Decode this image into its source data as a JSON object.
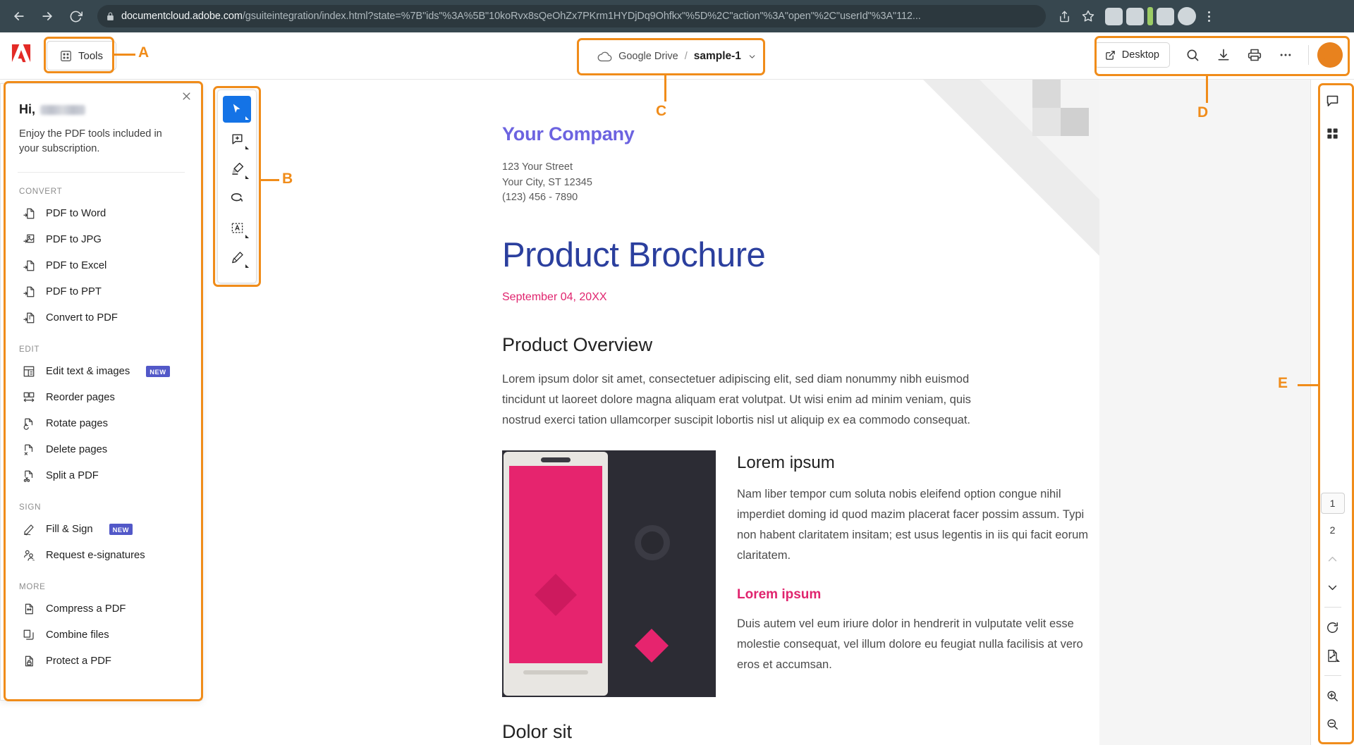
{
  "browser": {
    "url_host": "documentcloud.adobe.com",
    "url_path": "/gsuiteintegration/index.html?state=%7B\"ids\"%3A%5B\"10koRvx8sQeOhZx7PKrm1HYDjDq9Ohfkx\"%5D%2C\"action\"%3A\"open\"%2C\"userId\"%3A\"112...",
    "back_icon": "back-arrow-icon",
    "forward_icon": "forward-arrow-icon",
    "reload_icon": "reload-icon",
    "lock_icon": "lock-icon",
    "share_icon": "share-icon",
    "bookmark_icon": "star-icon",
    "menu_icon": "kebab-menu-icon"
  },
  "header": {
    "logo": "adobe-logo",
    "tools_label": "Tools",
    "tools_icon": "grid-icon",
    "breadcrumb": {
      "cloud_icon": "cloud-icon",
      "source": "Google Drive",
      "separator": "/",
      "file": "sample-1",
      "chevron_icon": "chevron-down-icon"
    },
    "desktop_label": "Desktop",
    "desktop_icon": "external-link-icon",
    "search_icon": "search-icon",
    "download_icon": "download-icon",
    "print_icon": "print-icon",
    "more_icon": "more-horizontal-icon",
    "avatar_icon": "user-avatar-icon"
  },
  "left_panel": {
    "close_icon": "close-icon",
    "greeting": "Hi,",
    "subtitle": "Enjoy the PDF tools included in your subscription.",
    "sections": [
      {
        "title": "CONVERT",
        "items": [
          {
            "label": "PDF to Word",
            "icon": "pdf-to-word-icon",
            "badge": ""
          },
          {
            "label": "PDF to JPG",
            "icon": "pdf-to-jpg-icon",
            "badge": ""
          },
          {
            "label": "PDF to Excel",
            "icon": "pdf-to-excel-icon",
            "badge": ""
          },
          {
            "label": "PDF to PPT",
            "icon": "pdf-to-ppt-icon",
            "badge": ""
          },
          {
            "label": "Convert to PDF",
            "icon": "convert-to-pdf-icon",
            "badge": ""
          }
        ]
      },
      {
        "title": "EDIT",
        "items": [
          {
            "label": "Edit text & images",
            "icon": "edit-text-images-icon",
            "badge": "NEW"
          },
          {
            "label": "Reorder pages",
            "icon": "reorder-pages-icon",
            "badge": ""
          },
          {
            "label": "Rotate pages",
            "icon": "rotate-pages-icon",
            "badge": ""
          },
          {
            "label": "Delete pages",
            "icon": "delete-pages-icon",
            "badge": ""
          },
          {
            "label": "Split a PDF",
            "icon": "split-pdf-icon",
            "badge": ""
          }
        ]
      },
      {
        "title": "SIGN",
        "items": [
          {
            "label": "Fill & Sign",
            "icon": "fill-sign-icon",
            "badge": "NEW"
          },
          {
            "label": "Request e-signatures",
            "icon": "request-esignatures-icon",
            "badge": ""
          }
        ]
      },
      {
        "title": "MORE",
        "items": [
          {
            "label": "Compress a PDF",
            "icon": "compress-pdf-icon",
            "badge": ""
          },
          {
            "label": "Combine files",
            "icon": "combine-files-icon",
            "badge": ""
          },
          {
            "label": "Protect a PDF",
            "icon": "protect-pdf-icon",
            "badge": ""
          }
        ]
      }
    ]
  },
  "annotation_toolbar": {
    "tools": [
      {
        "name": "select-tool",
        "icon": "cursor-icon",
        "active": true
      },
      {
        "name": "add-comment-tool",
        "icon": "comment-plus-icon",
        "active": false
      },
      {
        "name": "highlight-tool",
        "icon": "highlighter-icon",
        "active": false
      },
      {
        "name": "freehand-tool",
        "icon": "loop-icon",
        "active": false
      },
      {
        "name": "text-box-tool",
        "icon": "text-box-icon",
        "active": false
      },
      {
        "name": "draw-tool",
        "icon": "pen-icon",
        "active": false
      }
    ]
  },
  "right_bar": {
    "comment_icon": "comment-icon",
    "thumbnails_icon": "grid-thumbnails-icon",
    "pages": [
      "1",
      "2"
    ],
    "selected_page": "1",
    "prev_icon": "chevron-up-icon",
    "next_icon": "chevron-down-icon",
    "rotate_icon": "rotate-clockwise-icon",
    "fit_page_icon": "fit-page-icon",
    "zoom_in_icon": "zoom-in-icon",
    "zoom_out_icon": "zoom-out-icon"
  },
  "document": {
    "company": "Your Company",
    "address_line1": "123 Your Street",
    "address_line2": "Your City, ST 12345",
    "address_line3": "(123) 456 - 7890",
    "title": "Product Brochure",
    "date": "September 04, 20XX",
    "section_heading": "Product Overview",
    "overview_text": "Lorem ipsum dolor sit amet, consectetuer adipiscing elit, sed diam nonummy nibh euismod tincidunt ut laoreet dolore magna aliquam erat volutpat. Ut wisi enim ad minim veniam, quis nostrud exerci tation ullamcorper suscipit lobortis nisl ut aliquip ex ea commodo consequat.",
    "sub_heading_1": "Lorem ipsum",
    "sub_text_1": "Nam liber tempor cum soluta nobis eleifend option congue nihil imperdiet doming id quod mazim placerat facer possim assum. Typi non habent claritatem insitam; est usus legentis in iis qui facit eorum claritatem.",
    "sub_heading_2": "Lorem ipsum",
    "sub_text_2": "Duis autem vel eum iriure dolor in hendrerit in vulputate velit esse molestie consequat, vel illum dolore eu feugiat nulla facilisis at vero eros et accumsan.",
    "section_heading_2": "Dolor sit"
  },
  "callouts": {
    "a": "A",
    "b": "B",
    "c": "C",
    "d": "D",
    "e": "E"
  },
  "colors": {
    "annotation": "#f08c1a",
    "accent_blue": "#1473e6",
    "badge_purple": "#5258c8",
    "doc_title_blue": "#2b3f9e",
    "doc_company_purple": "#6c63e0",
    "doc_pink": "#e0246e",
    "avatar_orange": "#e8821e"
  }
}
